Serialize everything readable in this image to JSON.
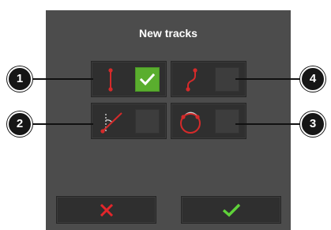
{
  "dialog": {
    "title": "New tracks",
    "options": [
      {
        "callout": "1",
        "icon": "ab-line-icon",
        "checked": true
      },
      {
        "callout": "2",
        "icon": "a-plus-line-icon",
        "checked": false
      },
      {
        "callout": "3",
        "icon": "circle-track-icon",
        "checked": false
      },
      {
        "callout": "4",
        "icon": "contour-track-icon",
        "checked": false
      }
    ],
    "buttons": {
      "cancel_icon": "cross-icon",
      "confirm_icon": "checkmark-icon"
    }
  },
  "colors": {
    "dialog_bg": "#4c4c4c",
    "tile_bg": "#2f2f2f",
    "track_red": "#d42a2a",
    "check_green": "#5aae2e",
    "confirm_green": "#5fd23a",
    "cancel_red": "#e3262b"
  }
}
